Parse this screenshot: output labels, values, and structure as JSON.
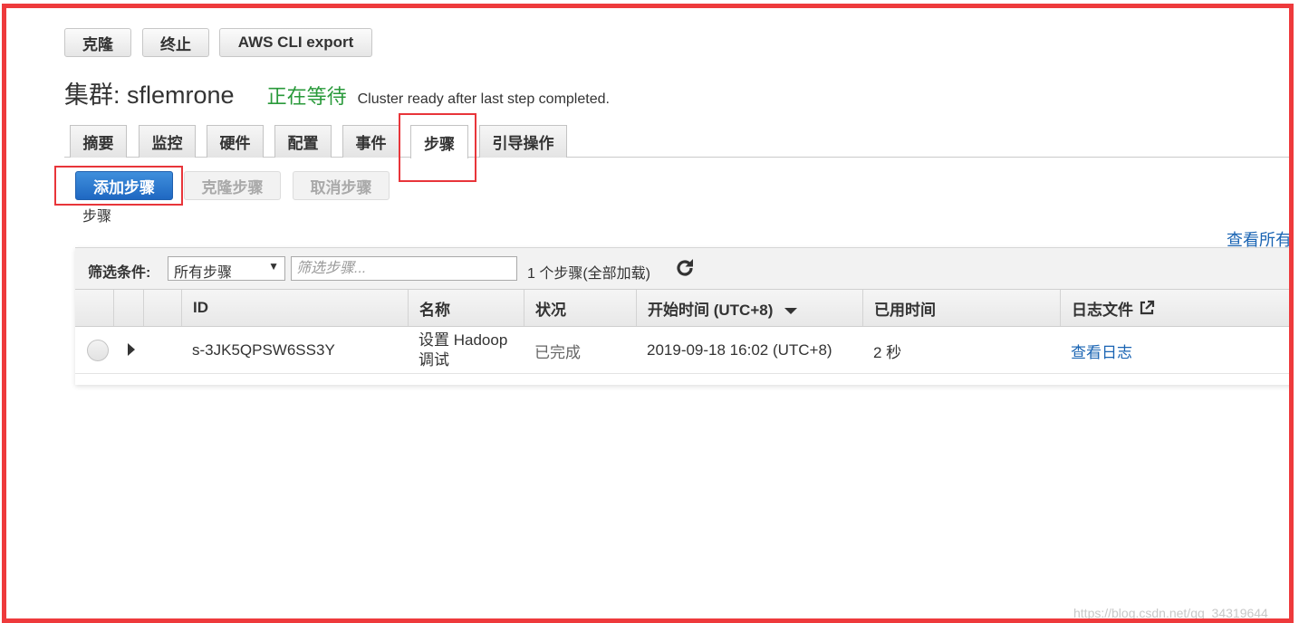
{
  "toolbar": {
    "clone_label": "克隆",
    "terminate_label": "终止",
    "cli_export_label": "AWS CLI export"
  },
  "cluster": {
    "title": "集群: sflemrone",
    "status": "正在等待",
    "status_note": "Cluster ready after last step completed."
  },
  "tabs": [
    {
      "label": "摘要"
    },
    {
      "label": "监控"
    },
    {
      "label": "硬件"
    },
    {
      "label": "配置"
    },
    {
      "label": "事件"
    },
    {
      "label": "步骤",
      "active": true
    },
    {
      "label": "引导操作"
    }
  ],
  "step_actions": {
    "add_label": "添加步骤",
    "clone_label": "克隆步骤",
    "cancel_label": "取消步骤"
  },
  "section_label": "步骤",
  "view_all_label": "查看所有",
  "filter": {
    "label": "筛选条件:",
    "selected": "所有步骤",
    "placeholder": "筛选步骤...",
    "count_text": "1 个步骤(全部加载)"
  },
  "table": {
    "columns": {
      "id": "ID",
      "name": "名称",
      "status": "状况",
      "start_time": "开始时间 (UTC+8)",
      "elapsed": "已用时间",
      "logs": "日志文件"
    },
    "rows": [
      {
        "id": "s-3JK5QPSW6SS3Y",
        "name_line1": "设置 Hadoop",
        "name_line2": "调试",
        "status": "已完成",
        "start_time": "2019-09-18 16:02 (UTC+8)",
        "elapsed": "2 秒",
        "logs": "查看日志"
      }
    ]
  },
  "colors": {
    "accent_blue": "#1f68c2",
    "status_green": "#2a9a3b",
    "highlight_red": "#ee3a3c",
    "link_blue": "#1a64b3"
  },
  "icons": {
    "refresh": "refresh-icon",
    "external": "external-link-icon",
    "sort": "sort-desc-icon",
    "expand": "expand-arrow-icon"
  },
  "watermark": "https://blog.csdn.net/qq_34319644"
}
